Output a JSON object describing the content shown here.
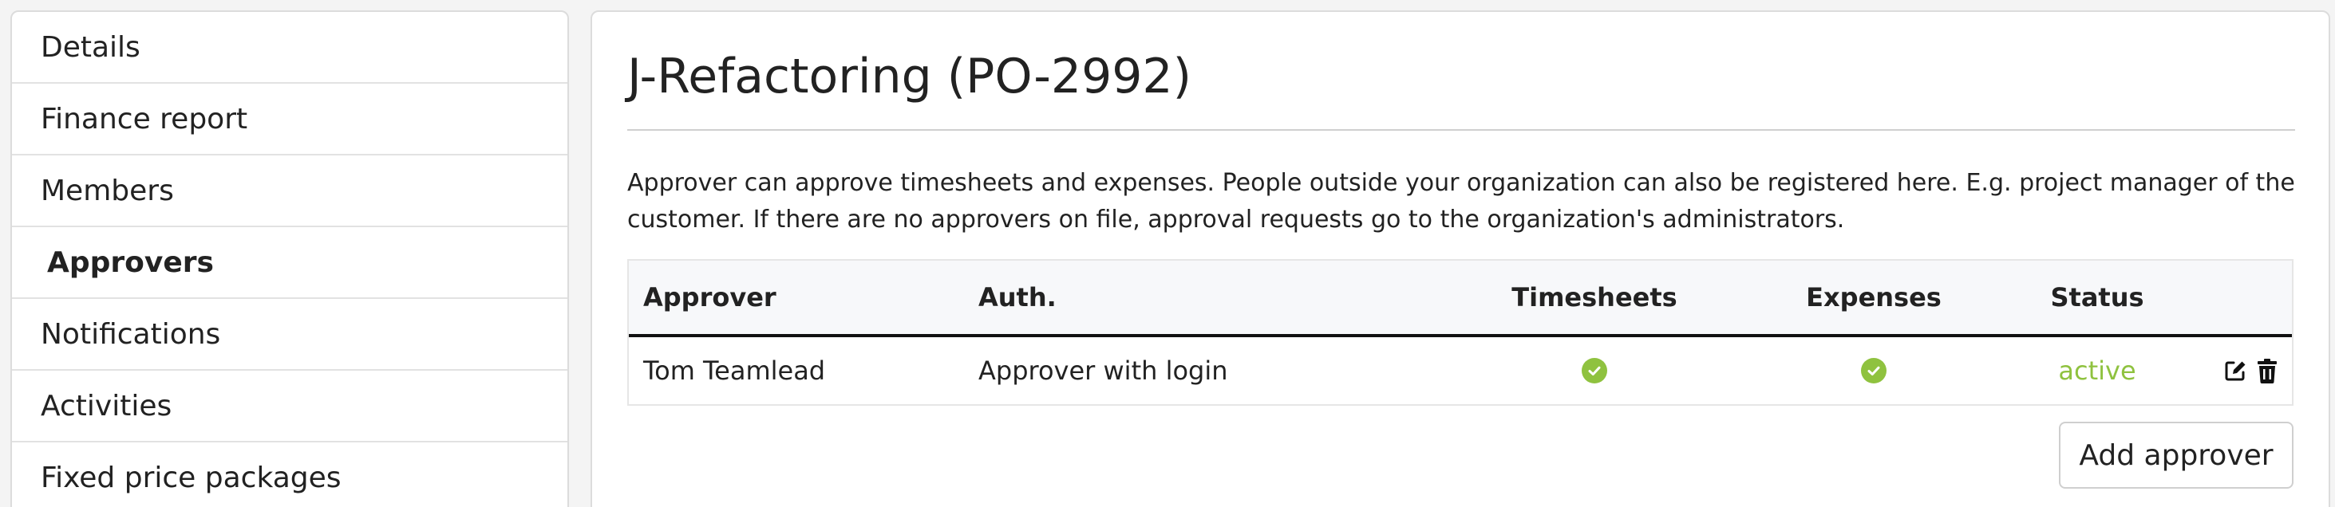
{
  "sidebar": {
    "items": [
      {
        "label": "Details"
      },
      {
        "label": "Finance report"
      },
      {
        "label": "Members"
      },
      {
        "label": "Approvers",
        "active": true
      },
      {
        "label": "Notifications"
      },
      {
        "label": "Activities"
      },
      {
        "label": "Fixed price packages"
      }
    ]
  },
  "main": {
    "title": "J-Refactoring (PO-2992)",
    "description": "Approver can approve timesheets and expenses. People outside your organization can also be registered here. E.g. project manager of the customer. If there are no approvers on file, approval requests go to the organization's administrators.",
    "table": {
      "headers": {
        "approver": "Approver",
        "auth": "Auth.",
        "timesheets": "Timesheets",
        "expenses": "Expenses",
        "status": "Status"
      },
      "rows": [
        {
          "approver": "Tom Teamlead",
          "auth": "Approver with login",
          "timesheets": "check-circle-icon",
          "expenses": "check-circle-icon",
          "status": "active"
        }
      ]
    },
    "add_button_label": "Add approver"
  },
  "colors": {
    "active_status": "#8fc23f",
    "check": "#8fc23f"
  }
}
